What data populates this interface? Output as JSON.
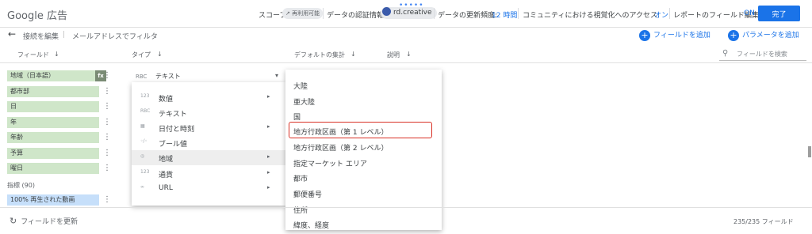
{
  "app": {
    "title": "Google 広告",
    "drag_handle": "•••••"
  },
  "topbar": {
    "scope_label": "スコープ:",
    "scope_chip": "↗ 再利用可能",
    "credentials_label": "データの認証情報:",
    "credentials_user": "rd.creative",
    "freshness_label": "データの更新頻度:",
    "freshness_value": "12 時間",
    "community_label": "コミュニティにおける視覚化へのアクセス:",
    "community_value": "オン",
    "report_edit_label": "レポートのフィールド編集:",
    "report_edit_value": "ON",
    "done_label": "完了"
  },
  "secondary": {
    "back_label": "接続を編集",
    "separator": "|",
    "filter_label": "メールアドレスでフィルタ",
    "add_field_label": "フィールドを追加",
    "add_param_label": "パラメータを追加",
    "plus": "+"
  },
  "columns": {
    "field": "フィールド",
    "type": "タイプ",
    "default_agg": "デフォルトの集計",
    "description": "説明",
    "search_placeholder": "フィールドを検索",
    "sort_arrow": "↓"
  },
  "fields": [
    {
      "label": "地域（日本語）",
      "badge": "fx"
    },
    {
      "label": "都市部"
    },
    {
      "label": "日"
    },
    {
      "label": "年"
    },
    {
      "label": "年齢"
    },
    {
      "label": "予算"
    },
    {
      "label": "曜日"
    }
  ],
  "metrics": {
    "label": "指標 (90)",
    "items": [
      {
        "label": "100% 再生された動画"
      }
    ]
  },
  "type_cell": {
    "prefix": "RBC",
    "value": "テキスト",
    "caret": "▾"
  },
  "type_menu": [
    {
      "icon": "123",
      "label": "数値",
      "arrow": "▸"
    },
    {
      "icon": "RBC",
      "label": "テキスト",
      "arrow": ""
    },
    {
      "icon": "▦",
      "label": "日付と時刻",
      "arrow": "▸"
    },
    {
      "icon": "◦/◦",
      "label": "ブール値",
      "arrow": ""
    },
    {
      "icon": "◎",
      "label": "地域",
      "arrow": "▸"
    },
    {
      "icon": "123",
      "label": "通貨",
      "arrow": "▸"
    },
    {
      "icon": "∞",
      "label": "URL",
      "arrow": "▸"
    }
  ],
  "geo_menu": [
    "大陸",
    "亜大陸",
    "国",
    "地方行政区画（第 1 レベル）",
    "地方行政区画（第 2 レベル）",
    "指定マーケット エリア",
    "都市",
    "郵便番号",
    "住所",
    "緯度、経度"
  ],
  "footer": {
    "refresh_label": "フィールドを更新",
    "count": "235/235 フィールド"
  },
  "icons": {
    "back": "←",
    "refresh": "↻",
    "search": "⚲",
    "kebab": "⋮",
    "scroll_up": "▲",
    "scroll_down": "▼"
  },
  "colors": {
    "accent": "#1a73e8",
    "dimension_pill": "#cfe6c9",
    "metric_pill": "#c6dffa",
    "highlight": "#d93025"
  }
}
